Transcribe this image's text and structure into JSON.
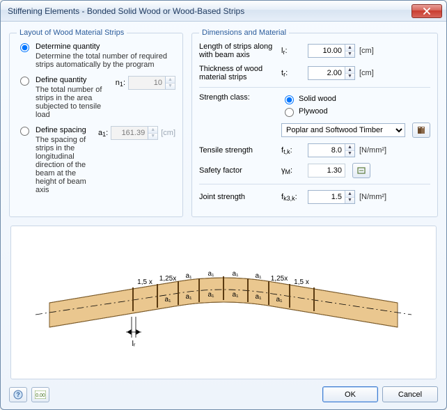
{
  "window": {
    "title": "Stiffening Elements - Bonded Solid Wood or Wood-Based Strips"
  },
  "layout_group": {
    "legend": "Layout of Wood Material Strips",
    "opt1_label": "Determine quantity",
    "opt1_desc": "Determine the total number of required strips automatically by the program",
    "opt2_label": "Define quantity",
    "opt2_desc": "The total number of strips in the area subjected to tensile load",
    "opt2_sym_pre": "n",
    "opt2_sym_sub": "1",
    "opt2_sym_post": ":",
    "opt2_value": "10",
    "opt3_label": "Define spacing",
    "opt3_desc": "The spacing of strips in the longitudinal direction of the beam at the height of beam axis",
    "opt3_sym_pre": "a",
    "opt3_sym_sub": "1",
    "opt3_sym_post": ":",
    "opt3_value": "161.39",
    "opt3_unit": "[cm]",
    "selected": "opt1"
  },
  "dim_group": {
    "legend": "Dimensions and Material",
    "length_label": "Length of strips along with beam axis",
    "length_sym_pre": "l",
    "length_sym_sub": "r",
    "length_sym_post": ":",
    "length_value": "10.00",
    "length_unit": "[cm]",
    "thick_label": "Thickness of wood material strips",
    "thick_sym_pre": "t",
    "thick_sym_sub": "r",
    "thick_sym_post": ":",
    "thick_value": "2.00",
    "thick_unit": "[cm]",
    "sc_label": "Strength class:",
    "sc_solid": "Solid wood",
    "sc_ply": "Plywood",
    "sc_selected": "solid",
    "combo": {
      "options": [
        "Poplar and Softwood Timber"
      ],
      "value": "Poplar and Softwood Timber"
    },
    "ts_label": "Tensile strength",
    "ts_sym_pre": "f",
    "ts_sym_sub": "t,k",
    "ts_sym_post": ":",
    "ts_value": "8.0",
    "ts_unit": "[N/mm²]",
    "sf_label": "Safety factor",
    "sf_sym_pre": "γ",
    "sf_sym_sub": "M",
    "sf_sym_post": ":",
    "sf_value": "1.30",
    "js_label": "Joint strength",
    "js_sym_pre": "f",
    "js_sym_sub": "k3,k",
    "js_sym_post": ":",
    "js_value": "1.5",
    "js_unit": "[N/mm²]"
  },
  "diagram": {
    "seg_labels": [
      "1,5 x",
      "1,25x",
      "a₁",
      "a₁",
      "a₁",
      "a₁",
      "1,25x",
      "1,5 x"
    ],
    "bottom_labels": [
      "a₁",
      "a₁",
      "a₁",
      "a₁",
      "a₁",
      "a₁"
    ],
    "lr_label": "lᵣ"
  },
  "footer": {
    "ok": "OK",
    "cancel": "Cancel"
  }
}
